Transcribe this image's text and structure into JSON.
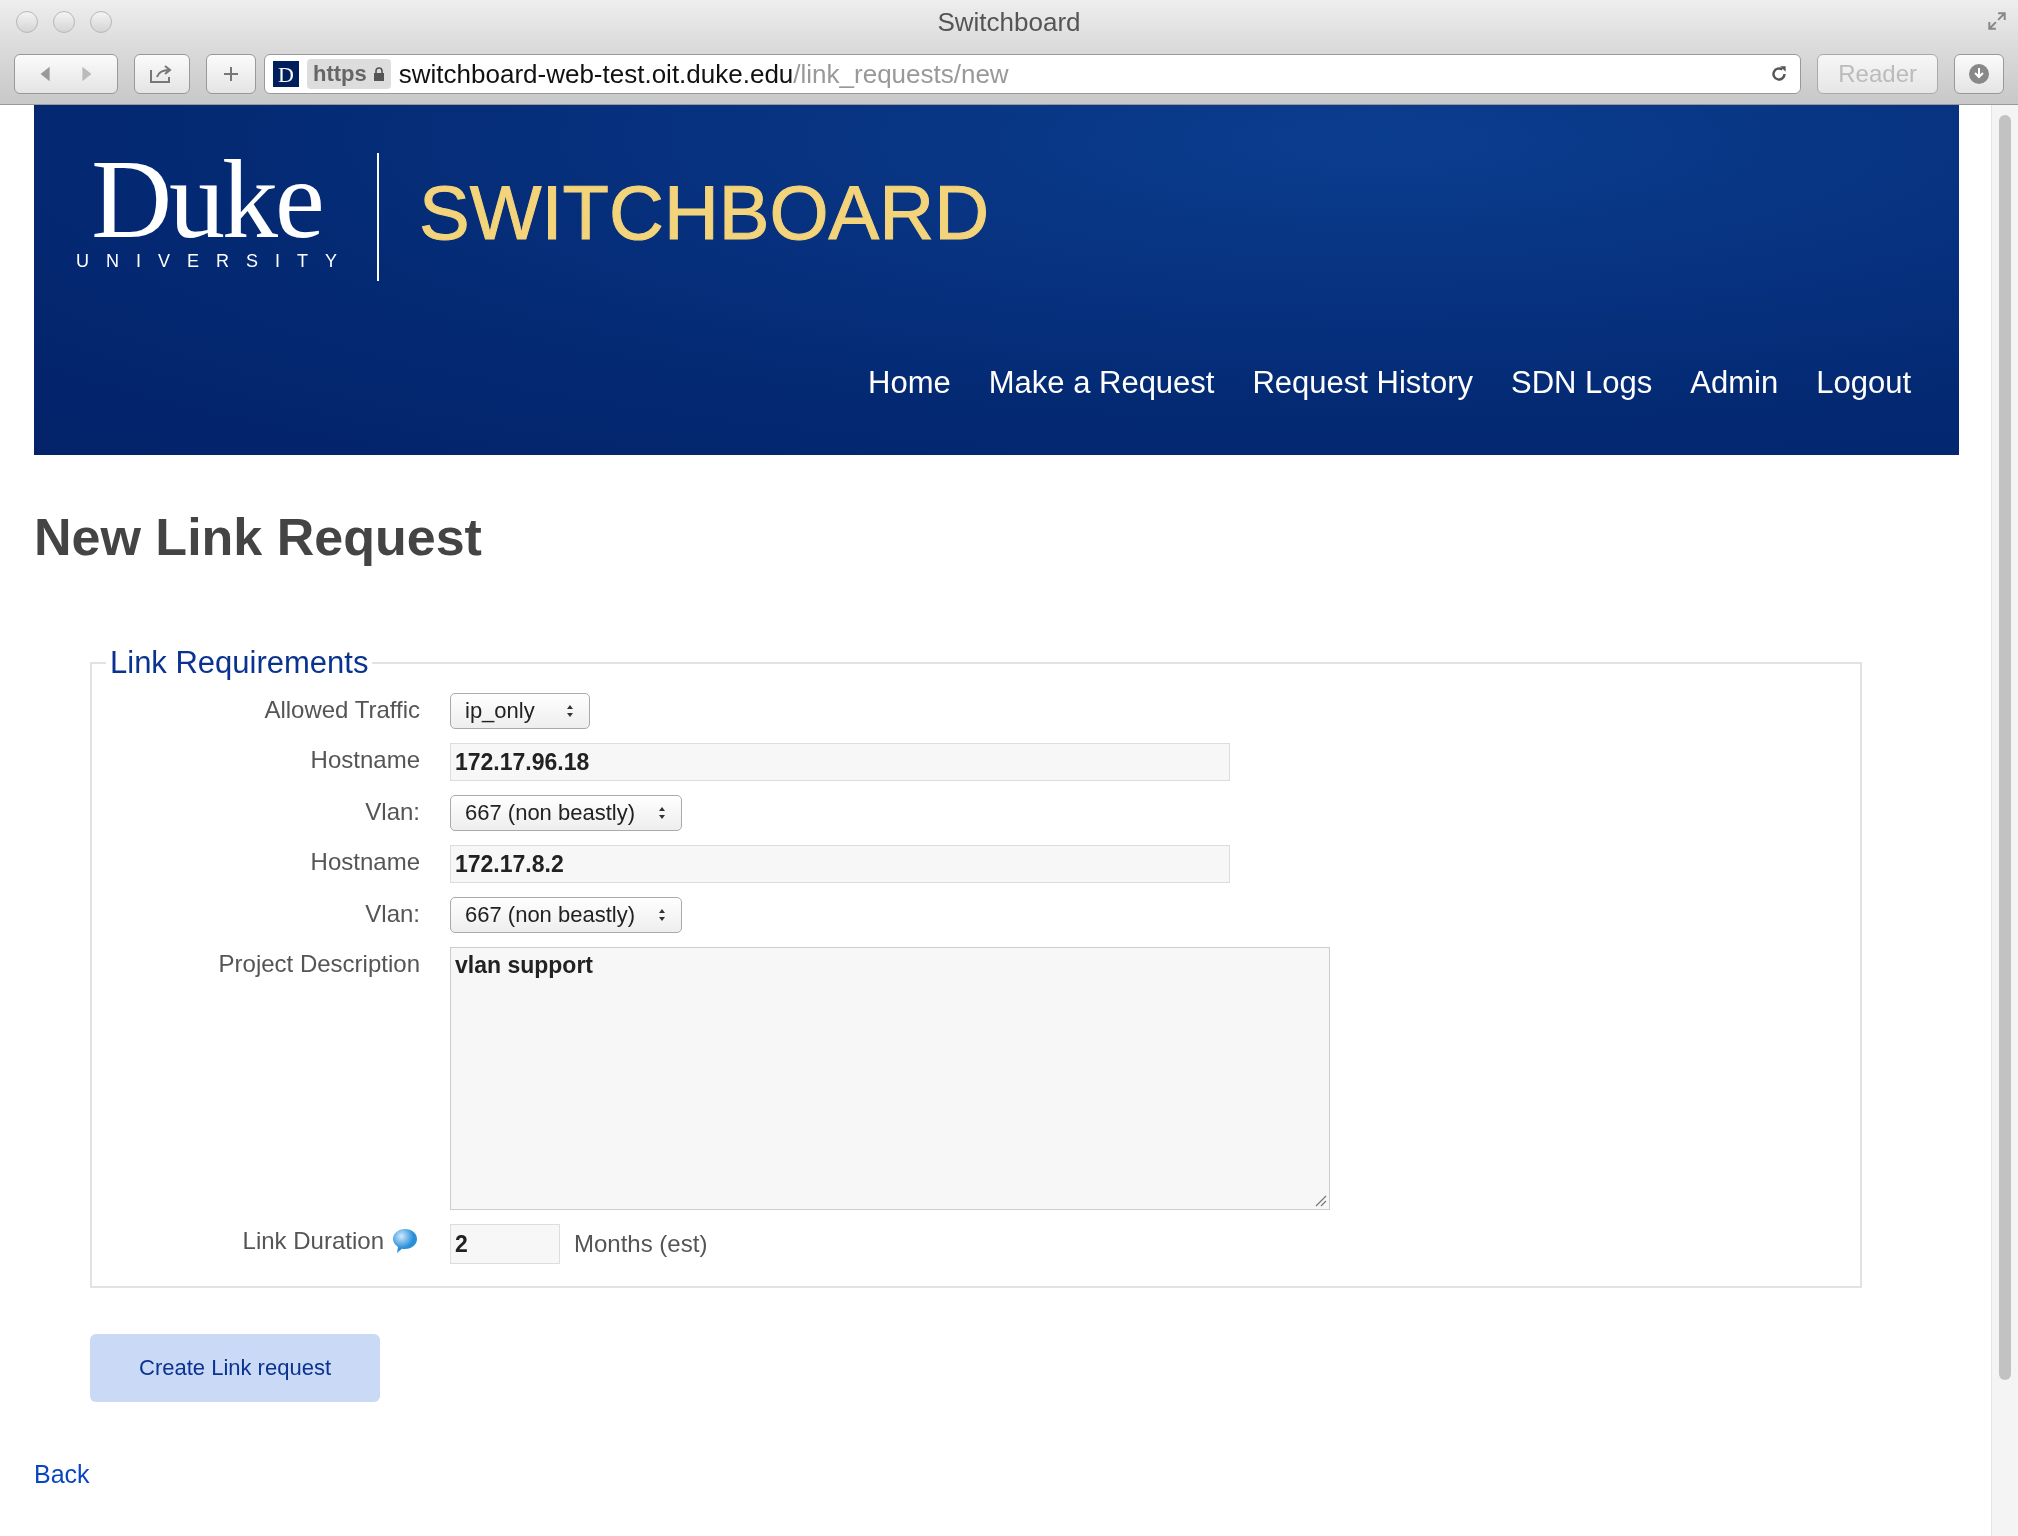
{
  "window": {
    "title": "Switchboard"
  },
  "address_bar": {
    "site_icon": "D",
    "scheme": "https",
    "host": "switchboard-web-test.oit.duke.edu",
    "path": "/link_requests/new",
    "reader": "Reader"
  },
  "logo": {
    "name": "Duke",
    "subtitle": "UNIVERSITY"
  },
  "site_title": "SWITCHBOARD",
  "nav": [
    "Home",
    "Make a Request",
    "Request History",
    "SDN Logs",
    "Admin",
    "Logout"
  ],
  "page_title": "New Link Request",
  "form": {
    "legend": "Link Requirements",
    "fields": [
      {
        "kind": "select",
        "label": "Allowed Traffic",
        "value": "ip_only"
      },
      {
        "kind": "text",
        "label": "Hostname",
        "value": "172.17.96.18"
      },
      {
        "kind": "select",
        "label": "Vlan:",
        "value": "667 (non beastly)"
      },
      {
        "kind": "text",
        "label": "Hostname",
        "value": "172.17.8.2"
      },
      {
        "kind": "select",
        "label": "Vlan:",
        "value": "667 (non beastly)"
      },
      {
        "kind": "textarea",
        "label": "Project Description",
        "value": "vlan support"
      },
      {
        "kind": "duration",
        "label": "Link Duration",
        "value": "2",
        "suffix": "Months (est)"
      }
    ]
  },
  "submit": "Create Link request",
  "back_link": "Back"
}
